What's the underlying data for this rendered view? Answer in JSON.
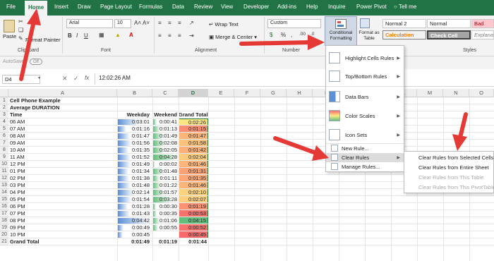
{
  "tabs": [
    "File",
    "Home",
    "Insert",
    "Draw",
    "Page Layout",
    "Formulas",
    "Data",
    "Review",
    "View",
    "Developer",
    "Add-ins",
    "Help",
    "Inquire",
    "Power Pivot"
  ],
  "tell_me": "Tell me",
  "ribbon": {
    "paste": "Paste",
    "format_painter": "Format Painter",
    "font_name": "Arial",
    "font_size": "10",
    "wrap_text": "Wrap Text",
    "merge_center": "Merge & Center",
    "number_format": "Custom",
    "conditional_formatting": "Conditional Formatting",
    "format_as_table": "Format as Table",
    "styles": [
      "Normal 2",
      "Normal",
      "Bad",
      "Calculation",
      "Check Cell",
      "Explanatory..."
    ],
    "groups": [
      "Clipboard",
      "Font",
      "Alignment",
      "Number",
      "Styles"
    ]
  },
  "qat": {
    "autosave": "AutoSave",
    "toggle": "Off"
  },
  "formula_bar": {
    "name_box": "D4",
    "fx": "fx",
    "content": "12:02:26 AM"
  },
  "columns": [
    "A",
    "B",
    "C",
    "D",
    "E",
    "F",
    "G",
    "H",
    "I",
    "J",
    "K",
    "L",
    "M",
    "N",
    "O"
  ],
  "rows": [
    {
      "n": "1",
      "a": "Cell Phone Example",
      "bold": true
    },
    {
      "n": "2",
      "a": "Average DURATION",
      "bold": true
    },
    {
      "n": "3",
      "a": "Time",
      "b": "Weekday",
      "c": "Weekend",
      "d": "Grand Total",
      "bold": true
    },
    {
      "n": "4",
      "a": "06 AM",
      "b": "0:03:01",
      "c": "0:00:41",
      "d": "0:02:26"
    },
    {
      "n": "5",
      "a": "07 AM",
      "b": "0:01:16",
      "c": "0:01:13",
      "d": "0:01:15"
    },
    {
      "n": "6",
      "a": "08 AM",
      "b": "0:01:47",
      "c": "0:01:49",
      "d": "0:01:47"
    },
    {
      "n": "7",
      "a": "09 AM",
      "b": "0:01:56",
      "c": "0:02:08",
      "d": "0:01:58"
    },
    {
      "n": "8",
      "a": "10 AM",
      "b": "0:01:35",
      "c": "0:02:05",
      "d": "0:01:42"
    },
    {
      "n": "9",
      "a": "11 AM",
      "b": "0:01:52",
      "c": "0:04:28",
      "d": "0:02:04"
    },
    {
      "n": "10",
      "a": "12 PM",
      "b": "0:01:49",
      "c": "0:00:02",
      "d": "0:01:46"
    },
    {
      "n": "11",
      "a": "01 PM",
      "b": "0:01:34",
      "c": "0:01:48",
      "d": "0:01:31"
    },
    {
      "n": "12",
      "a": "02 PM",
      "b": "0:01:38",
      "c": "0:01:11",
      "d": "0:01:35"
    },
    {
      "n": "13",
      "a": "03 PM",
      "b": "0:01:48",
      "c": "0:01:22",
      "d": "0:01:46"
    },
    {
      "n": "14",
      "a": "04 PM",
      "b": "0:02:14",
      "c": "0:01:57",
      "d": "0:02:10"
    },
    {
      "n": "15",
      "a": "05 PM",
      "b": "0:01:54",
      "c": "0:03:28",
      "d": "0:02:07"
    },
    {
      "n": "16",
      "a": "06 PM",
      "b": "0:01:28",
      "c": "0:00:30",
      "d": "0:01:19"
    },
    {
      "n": "17",
      "a": "07 PM",
      "b": "0:01:43",
      "c": "0:00:35",
      "d": "0:00:53"
    },
    {
      "n": "18",
      "a": "08 PM",
      "b": "0:04:42",
      "c": "0:01:06",
      "d": "0:04:15"
    },
    {
      "n": "19",
      "a": "09 PM",
      "b": "0:00:49",
      "c": "0:00:55",
      "d": "0:00:52"
    },
    {
      "n": "20",
      "a": "10 PM",
      "b": "0:00:45",
      "c": "",
      "d": "0:00:45"
    },
    {
      "n": "21",
      "a": "Grand Total",
      "b": "0:01:49",
      "c": "0:01:19",
      "d": "0:01:44",
      "bold": true
    }
  ],
  "cf_menu": [
    "Highlight Cells Rules",
    "Top/Bottom Rules",
    "Data Bars",
    "Color Scales",
    "Icon Sets",
    "New Rule...",
    "Clear Rules",
    "Manage Rules..."
  ],
  "clear_submenu": [
    "Clear Rules from Selected Cells",
    "Clear Rules from Entire Sheet",
    "Clear Rules from This Table",
    "Clear Rules from This PivotTable"
  ],
  "colors": {
    "excel_green": "#217346",
    "arrow_red": "#e53935",
    "menu_hover": "#dcdcdc",
    "bar_blue": "#5b8fd6"
  }
}
